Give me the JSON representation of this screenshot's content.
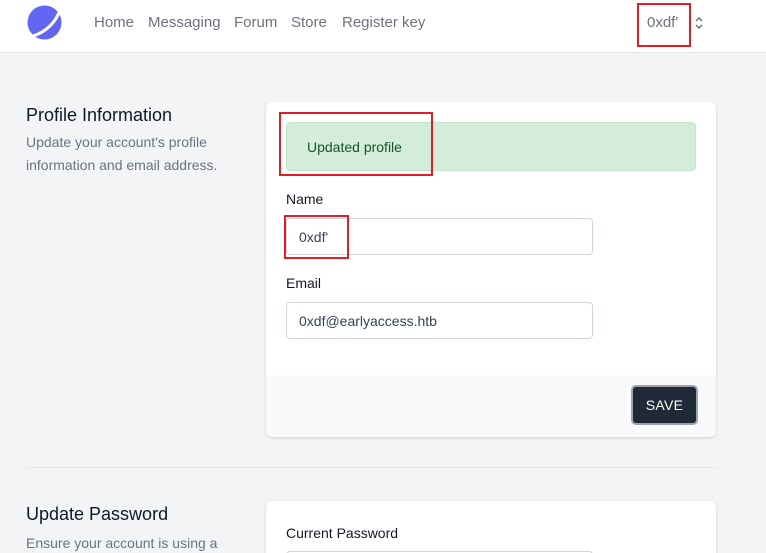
{
  "nav": {
    "links": [
      "Home",
      "Messaging",
      "Forum",
      "Store",
      "Register key"
    ],
    "user_name": "0xdf'"
  },
  "profile_section": {
    "title": "Profile Information",
    "description": "Update your account's profile information and email address.",
    "alert": "Updated profile",
    "name_label": "Name",
    "name_value": "0xdf'",
    "email_label": "Email",
    "email_value": "0xdf@earlyaccess.htb",
    "save_label": "SAVE"
  },
  "password_section": {
    "title": "Update Password",
    "description": "Ensure your account is using a",
    "current_password_label": "Current Password"
  },
  "colors": {
    "accent": "#6366f1",
    "highlight": "#e21d24",
    "alert_bg": "#d4edda",
    "alert_text": "#155724",
    "button_bg": "#1f2937"
  }
}
